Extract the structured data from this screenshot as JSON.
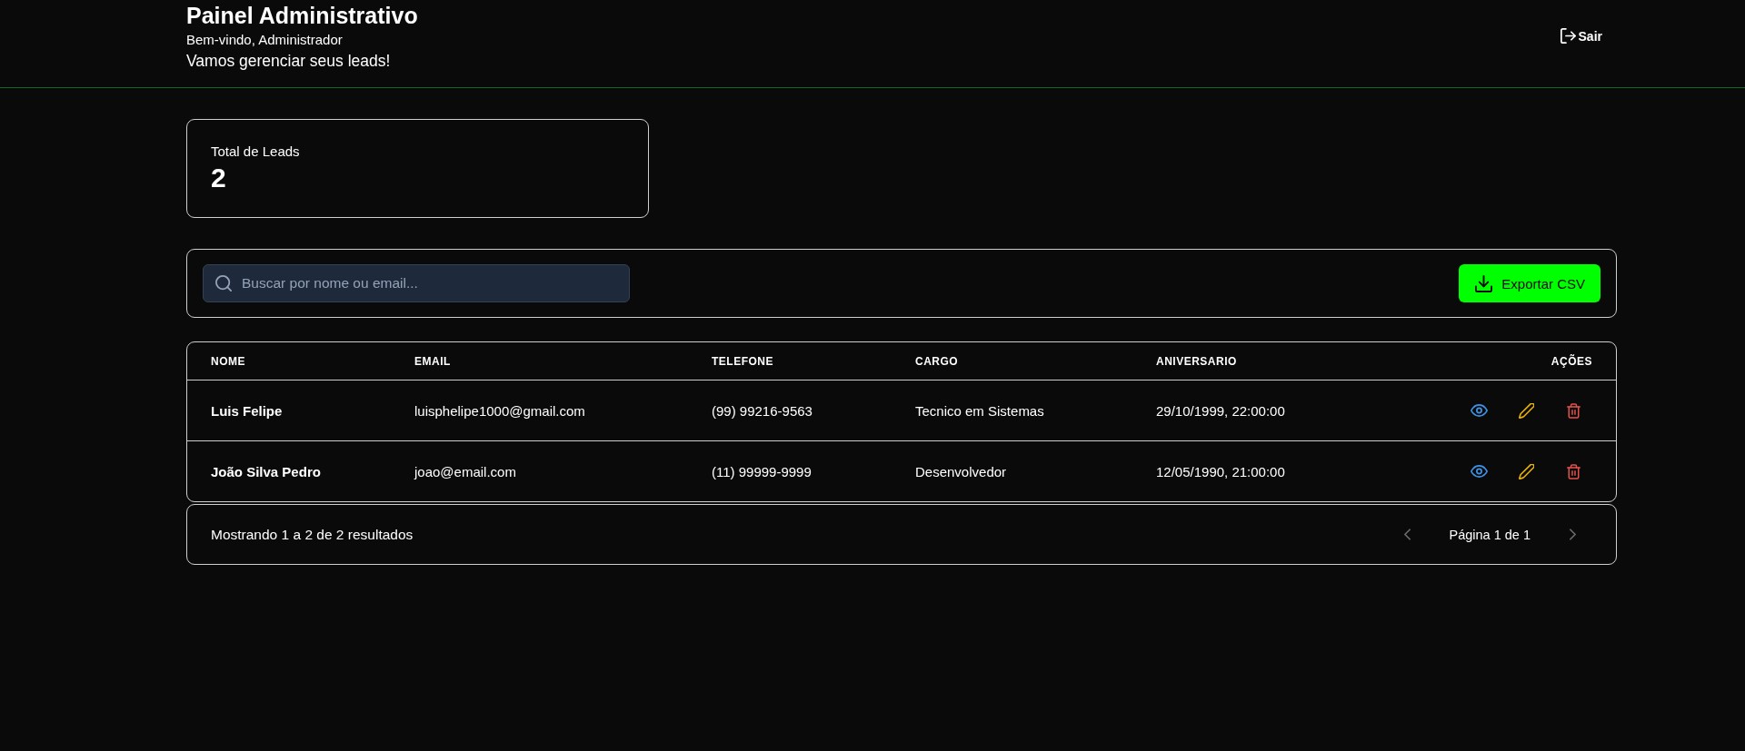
{
  "header": {
    "title": "Painel Administrativo",
    "welcome": "Bem-vindo, Administrador",
    "subtitle": "Vamos gerenciar seus leads!",
    "logout_button": "Sair"
  },
  "stats": [
    {
      "label": "Total de Leads",
      "value": "2"
    }
  ],
  "toolbar": {
    "search": {
      "placeholder": "Buscar por nome ou email..."
    },
    "export_button": "Exportar CSV"
  },
  "table": {
    "columns": [
      "NOME",
      "EMAIL",
      "TELEFONE",
      "CARGO",
      "ANIVERSARIO",
      "AÇÕES"
    ],
    "rows": [
      {
        "cells": [
          "Luis Felipe",
          "luisphelipe1000@gmail.com",
          "(99) 99216-9563",
          "Tecnico em Sistemas",
          "29/10/1999, 22:00:00"
        ],
        "actions": [
          {
            "kind": "view",
            "color": "#3e92e6"
          },
          {
            "kind": "edit",
            "color": "#eab308"
          },
          {
            "kind": "delete",
            "color": "#e5504b"
          }
        ]
      },
      {
        "cells": [
          "João Silva Pedro",
          "joao@email.com",
          "(11) 99999-9999",
          "Desenvolvedor",
          "12/05/1990, 21:00:00"
        ],
        "actions": [
          {
            "kind": "view",
            "color": "#3e92e6"
          },
          {
            "kind": "edit",
            "color": "#eab308"
          },
          {
            "kind": "delete",
            "color": "#e5504b"
          }
        ]
      }
    ]
  },
  "pagination": {
    "summary": "Mostrando 1 a 2 de 2 resultados",
    "page_label": "Página 1 de 1",
    "previous": {
      "disabled": true
    },
    "next": {
      "disabled": true
    }
  }
}
